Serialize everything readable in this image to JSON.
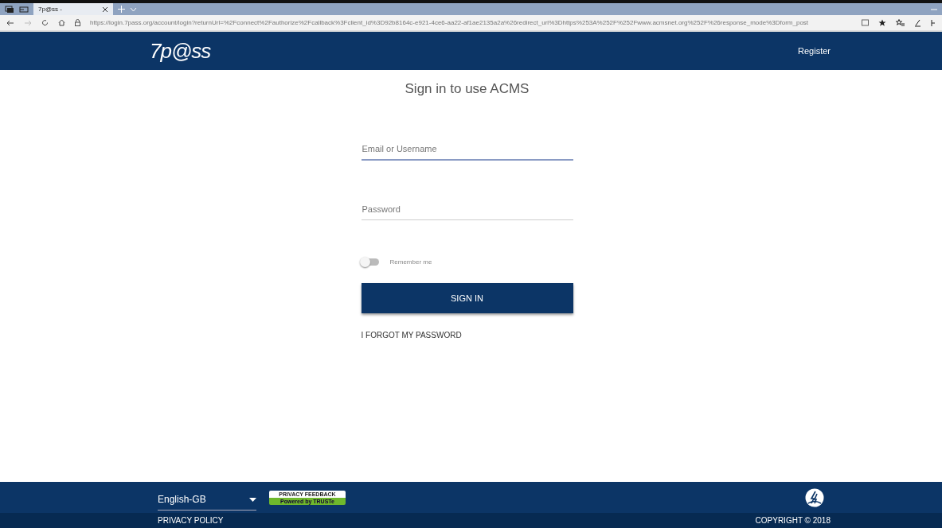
{
  "browser": {
    "tab_title": "7p@ss -",
    "url": "https://login.7pass.org/account/login?returnUrl=%2Fconnect%2Fauthorize%2Fcallback%3Fclient_id%3D92b8164c-e921-4ce6-aa22-af1ae2135a2a%26redirect_uri%3Dhttps%253A%252F%252Fwww.acmsnet.org%252F%26response_mode%3Dform_post"
  },
  "header": {
    "logo": "7p@ss",
    "register_link": "Register"
  },
  "form": {
    "title": "Sign in to use ACMS",
    "email": {
      "placeholder": "Email or Username"
    },
    "password": {
      "placeholder": "Password"
    },
    "remember": {
      "label": "Remember me",
      "on": false
    },
    "submit": "SIGN IN",
    "forgot": "I FORGOT MY PASSWORD"
  },
  "footer": {
    "language": "English-GB",
    "privacy_badge": {
      "top": "PRIVACY FEEDBACK",
      "bottom": "Powered by TRUSTe"
    },
    "privacy_policy": "PRIVACY POLICY",
    "copyright": "COPYRIGHT © 2018"
  }
}
